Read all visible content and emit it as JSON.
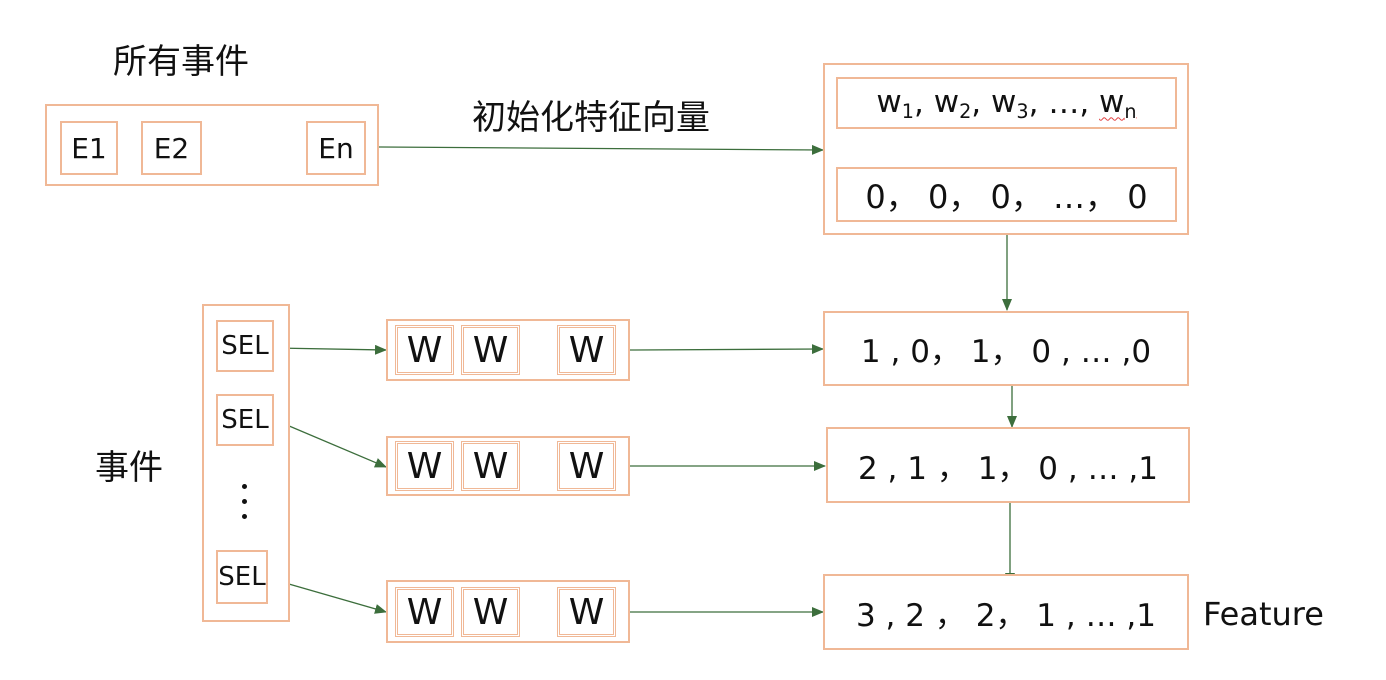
{
  "all_events": {
    "title": "所有事件",
    "items": [
      "E1",
      "E2",
      "En"
    ]
  },
  "init_label": "初始化特征向量",
  "vector_box": {
    "weights": {
      "w1": "w",
      "w1_sub": "1",
      "w2": "w",
      "w2_sub": "2",
      "w3": "w",
      "w3_sub": "3",
      "ellipsis": "…,",
      "wn": "w",
      "wn_sub": "n"
    },
    "zeros": "0， 0， 0， …， 0"
  },
  "events_label": "事件",
  "sel_items": [
    "SEL",
    "SEL",
    "SEL"
  ],
  "w_rows": [
    [
      "W",
      "W",
      "W"
    ],
    [
      "W",
      "W",
      "W"
    ],
    [
      "W",
      "W",
      "W"
    ]
  ],
  "result_rows": [
    "1 , 0， 1， 0 , … ,0",
    "2 , 1 ， 1， 0 , … ,1",
    "3 , 2 ， 2， 1 , … ,1"
  ],
  "feature_label": "Feature",
  "colors": {
    "box_border": "#f0b896",
    "arrow": "#3c6e3c"
  }
}
